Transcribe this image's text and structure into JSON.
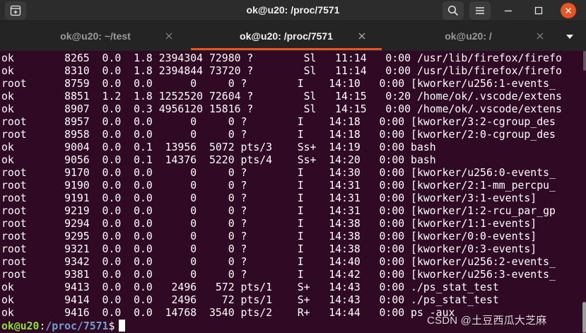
{
  "window": {
    "title": "ok@u20: /proc/7571"
  },
  "tabs": [
    {
      "label": "ok@u20: ~/test",
      "active": false
    },
    {
      "label": "ok@u20: /proc/7571",
      "active": true
    },
    {
      "label": "ok@u20: /",
      "active": false
    }
  ],
  "icons": {
    "new_tab": "new-tab-icon",
    "search": "search-icon",
    "menu": "hamburger-menu-icon",
    "minimize": "minimize-icon",
    "maximize": "maximize-icon",
    "close": "close-icon",
    "tab_close": "tab-close-icon",
    "tab_list": "chevron-down-icon"
  },
  "colors": {
    "terminal_bg": "#300a24",
    "accent": "#e95420",
    "prompt_user": "#8ae234",
    "prompt_path": "#729fcf"
  },
  "terminal": {
    "lines": [
      "ok        8265  0.0  1.8 2394304 72980 ?        Sl   11:14   0:00 /usr/lib/firefox/firefo",
      "ok        8310  0.0  1.8 2394844 73720 ?        Sl   11:14   0:00 /usr/lib/firefox/firefo",
      "root      8759  0.0  0.0      0     0 ?        I    14:10   0:00 [kworker/u256:1-events_",
      "ok        8851  1.2  1.8 1252520 72604 ?        Sl   14:15   0:20 /home/ok/.vscode/extens",
      "ok        8907  0.0  0.3 4956120 15816 ?        Sl   14:15   0:00 /home/ok/.vscode/extens",
      "root      8957  0.0  0.0      0     0 ?        I    14:18   0:00 [kworker/3:2-cgroup_des",
      "root      8958  0.0  0.0      0     0 ?        I    14:18   0:00 [kworker/2:0-cgroup_des",
      "ok        9004  0.0  0.1  13956  5072 pts/3    Ss+  14:19   0:00 bash",
      "ok        9056  0.0  0.1  14376  5220 pts/4    Ss+  14:20   0:00 bash",
      "root      9170  0.0  0.0      0     0 ?        I    14:30   0:00 [kworker/u256:0-events_",
      "root      9190  0.0  0.0      0     0 ?        I    14:31   0:00 [kworker/2:1-mm_percpu_",
      "root      9191  0.0  0.0      0     0 ?        I    14:31   0:00 [kworker/3:1-events]",
      "root      9219  0.0  0.0      0     0 ?        I    14:31   0:00 [kworker/1:2-rcu_par_gp",
      "root      9294  0.0  0.0      0     0 ?        I    14:38   0:00 [kworker/1:1-events]",
      "root      9295  0.0  0.0      0     0 ?        I    14:38   0:00 [kworker/0:0-events]",
      "root      9321  0.0  0.0      0     0 ?        I    14:38   0:00 [kworker/0:3-events]",
      "root      9342  0.0  0.0      0     0 ?        I    14:40   0:00 [kworker/u256:2-events_",
      "root      9381  0.0  0.0      0     0 ?        I    14:42   0:00 [kworker/u256:3-events_",
      "ok        9413  0.0  0.0   2496   572 pts/1    S+   14:43   0:00 ./ps_stat_test",
      "ok        9414  0.0  0.0   2496    72 pts/1    S+   14:43   0:00 ./ps_stat_test",
      "ok        9416  0.0  0.0  14768  3540 pts/2    R+   14:44   0:00 ps -aux"
    ],
    "prompt": {
      "user_host": "ok@u20",
      "separator": ":",
      "path": "/proc/7571",
      "symbol": "$"
    }
  },
  "watermark": "CSDN @土豆西瓜大芝麻"
}
